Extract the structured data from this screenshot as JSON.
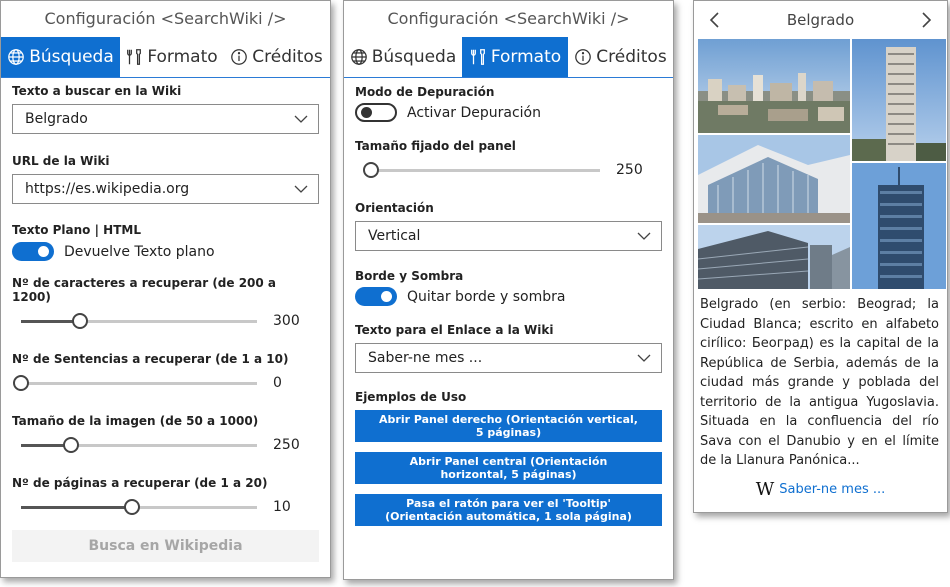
{
  "panel1": {
    "title": "Configuración <SearchWiki />",
    "tabs": [
      {
        "label": "Búsqueda",
        "icon": "globe-icon",
        "active": true
      },
      {
        "label": "Formato",
        "icon": "tools-icon",
        "active": false
      },
      {
        "label": "Créditos",
        "icon": "info-icon",
        "active": false
      }
    ],
    "search_label": "Texto a buscar en la Wiki",
    "search_value": "Belgrado",
    "url_label": "URL de la Wiki",
    "url_value": "https://es.wikipedia.org",
    "format_label": "Texto Plano | HTML",
    "format_toggle_text": "Devuelve Texto plano",
    "format_toggle_on": true,
    "chars_label": "Nº de caracteres a recuperar (de 200 a 1200)",
    "chars_value": "300",
    "chars_fraction": 0.25,
    "sentences_label": "Nº de Sentencias a recuperar (de 1 a 10)",
    "sentences_value": "0",
    "sentences_fraction": 0.0,
    "image_label": "Tamaño de la imagen (de 50 a 1000)",
    "image_value": "250",
    "image_fraction": 0.21,
    "pages_label": "Nº de páginas a recuperar (de 1 a 20)",
    "pages_value": "10",
    "pages_fraction": 0.47,
    "search_button": "Busca en Wikipedia"
  },
  "panel2": {
    "title": "Configuración <SearchWiki />",
    "tabs": [
      {
        "label": "Búsqueda",
        "icon": "globe-icon",
        "active": false
      },
      {
        "label": "Formato",
        "icon": "tools-icon",
        "active": true
      },
      {
        "label": "Créditos",
        "icon": "info-icon",
        "active": false
      }
    ],
    "debug_label": "Modo de Depuración",
    "debug_toggle_text": "Activar Depuración",
    "debug_toggle_on": false,
    "panel_size_label": "Tamaño fijado del panel",
    "panel_size_value": "250",
    "panel_size_fraction": 0.03,
    "orientation_label": "Orientación",
    "orientation_value": "Vertical",
    "border_label": "Borde y Sombra",
    "border_toggle_text": "Quitar borde y sombra",
    "border_toggle_on": true,
    "link_label": "Texto para el Enlace a la Wiki",
    "link_value": "Saber-ne mes ...",
    "examples_label": "Ejemplos de Uso",
    "example_buttons": [
      "Abrir Panel derecho (Orientación vertical, 5 páginas)",
      "Abrir Panel central (Orientación horizontal, 5 páginas)",
      "Pasa el ratón para ver el 'Tooltip' (Orientación automática, 1 sola página)"
    ]
  },
  "panel3": {
    "title": "Belgrado",
    "article": "Belgrado (en serbio: Beograd; la Ciudad Blanca; escrito en alfabeto cirílico: Београд) es la capital de la República de Serbia, además de la ciudad más grande y poblada del territorio de la antigua Yugoslavia. Situada en la confluencia del río Sava con el Danubio y en el límite de la Llanura Panónica...",
    "more_link": "Saber-ne mes ...",
    "logo_letter": "W"
  },
  "colors": {
    "accent": "#0f6fd0",
    "disabled_bg": "#f3f3f3",
    "disabled_text": "#a6a6a6"
  }
}
